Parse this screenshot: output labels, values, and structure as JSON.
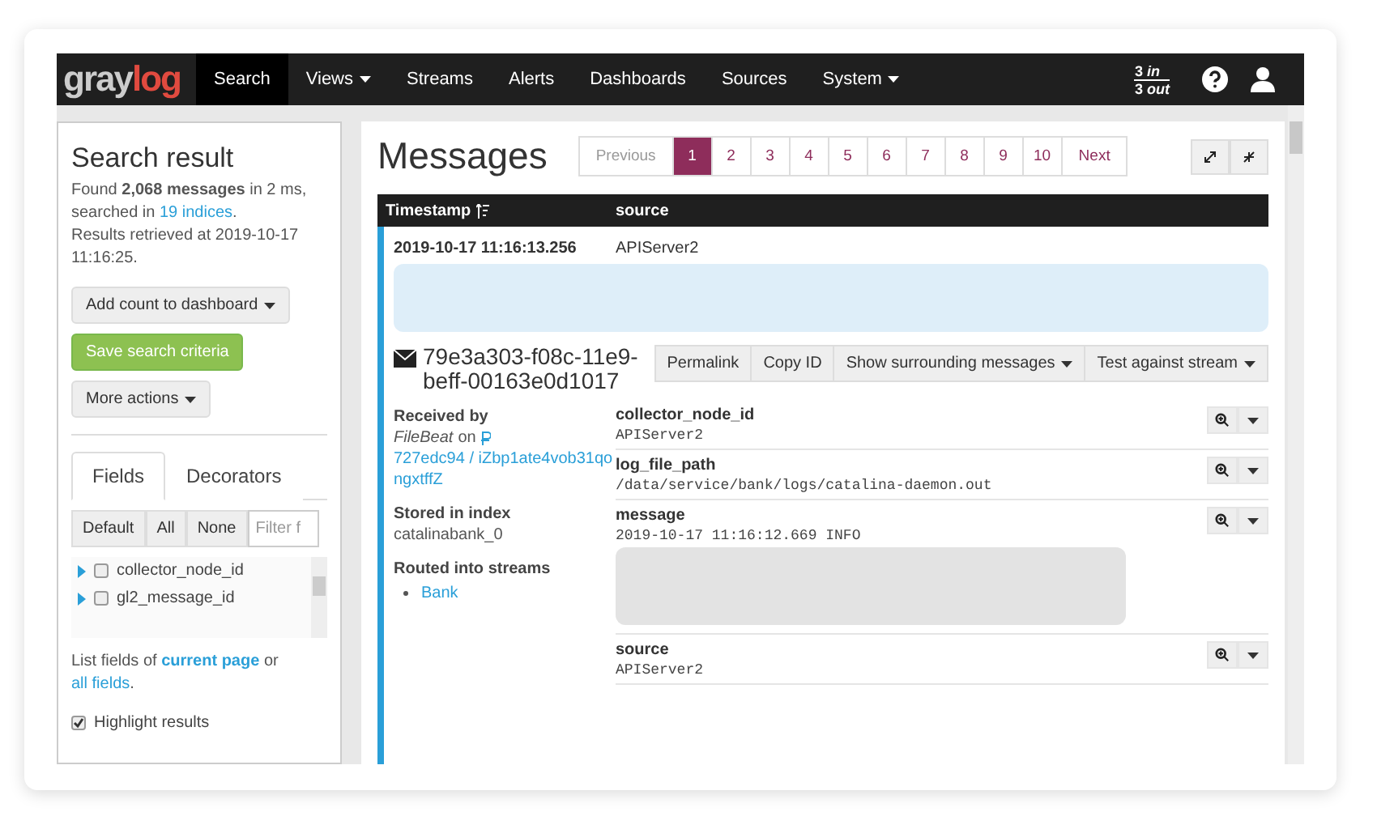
{
  "navbar": {
    "logo": {
      "first": "gray",
      "second": "log"
    },
    "items": [
      {
        "label": "Search",
        "selected": true,
        "dropdown": false
      },
      {
        "label": "Views",
        "selected": false,
        "dropdown": true
      },
      {
        "label": "Streams",
        "selected": false,
        "dropdown": false
      },
      {
        "label": "Alerts",
        "selected": false,
        "dropdown": false
      },
      {
        "label": "Dashboards",
        "selected": false,
        "dropdown": false
      },
      {
        "label": "Sources",
        "selected": false,
        "dropdown": false
      },
      {
        "label": "System",
        "selected": false,
        "dropdown": true
      }
    ],
    "throughput": {
      "in": "3 *in*",
      "out": "3 *out*"
    }
  },
  "sidebar": {
    "title": "Search result",
    "summary": {
      "before": "Found **2,068 messages** in 2 ms, searched in",
      "link": "19 indices",
      "after": "."
    },
    "retrieved": "Results retrieved at 2019-10-17 11:16:25.",
    "actions": [
      {
        "label": "Add count to dashboard",
        "kind": "dropdown"
      },
      {
        "label": "Save search criteria",
        "kind": "primary"
      },
      {
        "label": "More actions",
        "kind": "dropdown"
      }
    ],
    "tabs": [
      {
        "label": "Fields",
        "selected": true
      },
      {
        "label": "Decorators",
        "selected": false
      }
    ],
    "field_filters": [
      "Default",
      "All",
      "None"
    ],
    "filter_placeholder": "Filter f",
    "fields": [
      {
        "name": "collector_node_id",
        "checked": false
      },
      {
        "name": "gl2_message_id",
        "checked": false
      }
    ],
    "list_fields": {
      "before": "List fields of",
      "link1": "current page",
      "middle": "or",
      "link2": "all fields",
      "after": "."
    },
    "highlight": {
      "label": "Highlight results",
      "checked": true
    }
  },
  "main": {
    "title": "Messages",
    "pagination": {
      "previous": "Previous",
      "next": "Next",
      "pages": [
        {
          "label": "1",
          "selected": true
        },
        {
          "label": "2",
          "selected": false
        },
        {
          "label": "3",
          "selected": false
        },
        {
          "label": "4",
          "selected": false
        },
        {
          "label": "5",
          "selected": false
        },
        {
          "label": "6",
          "selected": false
        },
        {
          "label": "7",
          "selected": false
        },
        {
          "label": "8",
          "selected": false
        },
        {
          "label": "9",
          "selected": false
        },
        {
          "label": "10",
          "selected": false
        }
      ]
    },
    "table": {
      "columns": [
        "Timestamp",
        "source"
      ],
      "row": {
        "timestamp": "2019-10-17 11:16:13.256",
        "source": "APIServer2"
      }
    },
    "detail": {
      "id": "79e3a303-f08c-11e9-beff-00163e0d1017",
      "actions": [
        {
          "label": "Permalink",
          "dropdown": false
        },
        {
          "label": "Copy ID",
          "dropdown": false
        },
        {
          "label": "Show surrounding messages",
          "dropdown": true
        },
        {
          "label": "Test against stream",
          "dropdown": true
        }
      ],
      "received_by": {
        "heading": "Received by",
        "input": "FileBeat",
        "on": "on",
        "node": "727edc94 / iZbp1ate4vob31qongxtffZ"
      },
      "stored": {
        "heading": "Stored in index",
        "value": "catalinabank_0"
      },
      "streams": {
        "heading": "Routed into streams",
        "items": [
          "Bank"
        ]
      },
      "fields": [
        {
          "name": "collector_node_id",
          "value": "APIServer2",
          "redacted": false
        },
        {
          "name": "log_file_path",
          "value": "/data/service/bank/logs/catalina-daemon.out",
          "redacted": false
        },
        {
          "name": "message",
          "value": "2019-10-17 11:16:12.669 INFO",
          "redacted": true
        },
        {
          "name": "source",
          "value": "APIServer2",
          "redacted": false
        }
      ]
    }
  }
}
